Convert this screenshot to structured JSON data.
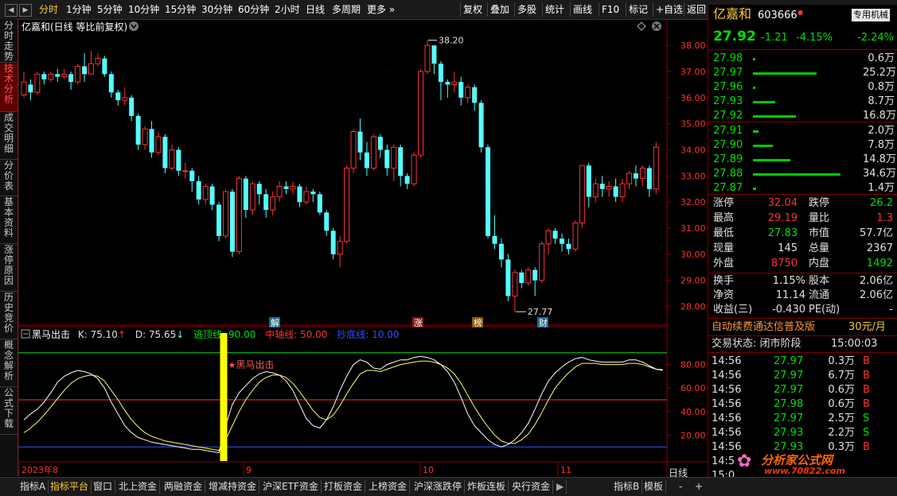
{
  "toolbar": {
    "periods": [
      "分时",
      "1分钟",
      "5分钟",
      "10分钟",
      "15分钟",
      "30分钟",
      "60分钟",
      "2小时",
      "日线",
      "多周期",
      "更多"
    ],
    "active_period": "分时",
    "tools": [
      "复权",
      "叠加",
      "多股",
      "统计",
      "画线",
      "F10",
      "标记",
      "+自选",
      "返回"
    ]
  },
  "left_tabs": [
    "分时走势",
    "技术分析",
    "成交明细",
    "分价表",
    "基本资料",
    "涨停原因",
    "历史竞价",
    "概念解析",
    "公式下载"
  ],
  "left_tab_active": "技术分析",
  "main_chart": {
    "title": "亿嘉和(日线 等比前复权)",
    "price_ticks": [
      "38.00",
      "37.00",
      "36.00",
      "35.00",
      "34.00",
      "33.00",
      "32.00",
      "31.00",
      "30.00",
      "29.00",
      "28.00"
    ],
    "high_label": "38.20",
    "low_label": "27.77",
    "event_markers": [
      "解",
      "涨",
      "榜",
      "财"
    ],
    "colors": {
      "up": "#ff3232",
      "down": "#54ffff",
      "grid": "#8b0000"
    }
  },
  "chart_data": {
    "type": "candlestick",
    "ylim": [
      27.5,
      38.4
    ],
    "candles": [
      [
        36.1,
        36.6,
        36.0,
        37.0
      ],
      [
        36.5,
        36.2,
        35.9,
        36.7
      ],
      [
        36.2,
        36.9,
        36.1,
        37.0
      ],
      [
        36.9,
        36.7,
        36.5,
        37.0
      ],
      [
        36.7,
        36.9,
        36.6,
        37.0
      ],
      [
        36.9,
        36.8,
        36.6,
        37.1
      ],
      [
        36.8,
        36.9,
        36.7,
        37.1
      ],
      [
        36.9,
        36.6,
        36.3,
        37.0
      ],
      [
        36.6,
        37.2,
        36.5,
        37.3
      ],
      [
        37.2,
        36.9,
        36.6,
        37.7
      ],
      [
        36.9,
        37.3,
        36.9,
        37.8
      ],
      [
        37.3,
        37.5,
        37.2,
        37.7
      ],
      [
        37.5,
        36.9,
        36.8,
        37.6
      ],
      [
        36.9,
        36.2,
        36.0,
        37.0
      ],
      [
        36.2,
        35.9,
        35.7,
        36.3
      ],
      [
        35.9,
        36.0,
        35.7,
        36.4
      ],
      [
        36.0,
        35.3,
        35.1,
        36.1
      ],
      [
        35.3,
        34.2,
        34.0,
        35.4
      ],
      [
        34.2,
        34.8,
        34.0,
        34.9
      ],
      [
        34.8,
        33.9,
        33.7,
        35.1
      ],
      [
        33.9,
        34.5,
        33.8,
        34.7
      ],
      [
        34.5,
        33.3,
        33.1,
        34.6
      ],
      [
        33.3,
        34.0,
        33.2,
        34.2
      ],
      [
        34.0,
        33.2,
        33.0,
        34.1
      ],
      [
        33.2,
        33.2,
        32.9,
        33.5
      ],
      [
        33.2,
        32.8,
        32.4,
        33.3
      ],
      [
        32.8,
        32.1,
        31.9,
        33.0
      ],
      [
        32.1,
        32.6,
        31.9,
        32.7
      ],
      [
        32.6,
        31.9,
        31.7,
        32.7
      ],
      [
        31.9,
        30.7,
        30.5,
        32.0
      ],
      [
        30.7,
        32.4,
        30.6,
        32.5
      ],
      [
        32.4,
        30.1,
        29.9,
        32.5
      ],
      [
        30.1,
        32.9,
        30.0,
        33.0
      ],
      [
        32.9,
        31.7,
        31.4,
        33.0
      ],
      [
        31.7,
        32.7,
        31.5,
        32.8
      ],
      [
        32.7,
        32.3,
        31.9,
        32.8
      ],
      [
        32.3,
        31.7,
        31.4,
        32.5
      ],
      [
        31.7,
        32.2,
        31.5,
        32.4
      ],
      [
        32.2,
        32.6,
        32.0,
        32.8
      ],
      [
        32.6,
        32.5,
        32.3,
        32.8
      ],
      [
        32.5,
        32.6,
        32.3,
        32.8
      ],
      [
        32.6,
        32.0,
        31.8,
        32.7
      ],
      [
        32.0,
        32.4,
        31.9,
        32.6
      ],
      [
        32.4,
        32.3,
        32.0,
        32.5
      ],
      [
        32.3,
        31.6,
        31.5,
        32.4
      ],
      [
        31.6,
        30.9,
        30.7,
        31.7
      ],
      [
        30.9,
        30.0,
        29.8,
        31.0
      ],
      [
        30.0,
        30.5,
        29.5,
        30.7
      ],
      [
        30.5,
        33.3,
        30.4,
        33.4
      ],
      [
        33.3,
        34.7,
        33.1,
        34.8
      ],
      [
        34.7,
        33.9,
        33.6,
        35.2
      ],
      [
        33.9,
        33.3,
        33.0,
        34.3
      ],
      [
        33.3,
        34.5,
        33.2,
        34.6
      ],
      [
        34.5,
        34.0,
        33.7,
        34.6
      ],
      [
        34.0,
        33.3,
        33.0,
        34.2
      ],
      [
        33.3,
        34.1,
        32.8,
        34.2
      ],
      [
        34.1,
        33.0,
        32.6,
        34.2
      ],
      [
        33.0,
        32.7,
        32.5,
        33.1
      ],
      [
        32.7,
        33.8,
        32.6,
        33.9
      ],
      [
        33.8,
        37.0,
        33.7,
        37.1
      ],
      [
        37.0,
        38.0,
        36.9,
        38.2
      ],
      [
        38.0,
        37.3,
        36.9,
        38.0
      ],
      [
        37.3,
        36.6,
        35.9,
        37.4
      ],
      [
        36.6,
        36.5,
        36.0,
        36.7
      ],
      [
        36.5,
        36.6,
        36.2,
        37.0
      ],
      [
        36.6,
        36.0,
        35.7,
        36.8
      ],
      [
        36.0,
        36.4,
        35.8,
        36.5
      ],
      [
        36.4,
        35.8,
        35.5,
        36.5
      ],
      [
        35.8,
        34.1,
        33.9,
        35.9
      ],
      [
        34.1,
        30.7,
        30.6,
        34.2
      ],
      [
        30.7,
        30.4,
        30.2,
        31.5
      ],
      [
        30.4,
        29.8,
        29.5,
        30.6
      ],
      [
        29.8,
        28.4,
        28.2,
        30.0
      ],
      [
        28.4,
        29.3,
        27.8,
        29.4
      ],
      [
        29.3,
        28.9,
        28.7,
        29.4
      ],
      [
        28.9,
        29.4,
        28.8,
        29.5
      ],
      [
        29.4,
        29.0,
        28.4,
        29.5
      ],
      [
        29.0,
        30.4,
        28.9,
        30.5
      ],
      [
        30.4,
        30.9,
        30.0,
        31.0
      ],
      [
        30.9,
        30.6,
        30.4,
        31.0
      ],
      [
        30.6,
        30.4,
        30.1,
        30.8
      ],
      [
        30.4,
        30.2,
        30.0,
        30.6
      ],
      [
        30.2,
        31.2,
        30.1,
        31.3
      ],
      [
        31.2,
        33.4,
        31.0,
        33.4
      ],
      [
        33.4,
        32.2,
        31.8,
        33.5
      ],
      [
        32.2,
        32.7,
        32.0,
        32.9
      ],
      [
        32.7,
        32.5,
        32.2,
        33.0
      ],
      [
        32.5,
        32.6,
        32.2,
        32.8
      ],
      [
        32.6,
        32.2,
        32.0,
        32.9
      ],
      [
        32.2,
        32.7,
        32.0,
        32.9
      ],
      [
        32.7,
        33.1,
        32.5,
        33.2
      ],
      [
        33.1,
        32.9,
        32.6,
        33.4
      ],
      [
        32.9,
        33.3,
        32.6,
        33.4
      ],
      [
        33.3,
        32.5,
        32.2,
        33.4
      ],
      [
        32.5,
        34.1,
        32.3,
        34.3
      ]
    ],
    "x_labels": [
      "2023年8",
      "9",
      "10",
      "11"
    ]
  },
  "indicator": {
    "name": "黑马出击",
    "k_label": "K: 75.10",
    "d_label": "D: 75.65",
    "top_line_label": "逃顶线: 90.00",
    "mid_line_label": "中轴线: 50.00",
    "bottom_line_label": "抄底线: 10.00",
    "signal_label": "黑马出击",
    "y_ticks": [
      "80.00",
      "60.00",
      "40.00",
      "20.00"
    ],
    "ylim": [
      0,
      100
    ],
    "levels": {
      "top": 90,
      "mid": 50,
      "bottom": 10
    },
    "k": [
      33,
      38,
      42,
      48,
      56,
      65,
      70,
      73,
      75,
      74,
      72,
      68,
      60,
      48,
      38,
      28,
      22,
      18,
      16,
      14,
      13,
      12,
      11,
      10,
      9,
      8,
      8,
      7,
      6,
      5,
      28,
      46,
      56,
      62,
      68,
      72,
      74,
      73,
      71,
      66,
      58,
      46,
      34,
      28,
      26,
      33,
      44,
      58,
      70,
      80,
      84,
      82,
      77,
      76,
      80,
      82,
      84,
      84,
      86,
      87,
      86,
      84,
      80,
      74,
      65,
      52,
      38,
      28,
      22,
      16,
      12,
      10,
      12,
      16,
      22,
      30,
      42,
      55,
      66,
      73,
      78,
      82,
      85,
      86,
      84,
      83,
      82,
      82,
      82,
      82,
      84,
      84,
      82,
      79,
      76,
      75
    ],
    "d": [
      22,
      26,
      31,
      37,
      44,
      51,
      58,
      64,
      68,
      70,
      71,
      70,
      66,
      58,
      50,
      41,
      33,
      27,
      22,
      19,
      17,
      15,
      14,
      13,
      12,
      11,
      10,
      9,
      8,
      7,
      16,
      28,
      40,
      50,
      58,
      65,
      69,
      71,
      71,
      69,
      64,
      57,
      49,
      41,
      35,
      33,
      37,
      45,
      55,
      64,
      72,
      75,
      75,
      74,
      76,
      78,
      80,
      81,
      82,
      83,
      83,
      82,
      80,
      77,
      72,
      64,
      54,
      44,
      35,
      27,
      20,
      15,
      13,
      13,
      16,
      21,
      29,
      39,
      50,
      60,
      67,
      73,
      78,
      81,
      81,
      81,
      80,
      80,
      80,
      80,
      81,
      81,
      80,
      78,
      76,
      75.65
    ]
  },
  "stock": {
    "name": "亿嘉和",
    "code": "603666",
    "tag": "专用机械",
    "price": "27.92",
    "change": "-1.21",
    "change_pct": "-4.15%",
    "industry_pct": "-2.24%"
  },
  "order_book": {
    "asks": [
      {
        "price": "27.98",
        "vol": "0.6万",
        "bar": 0.02
      },
      {
        "price": "27.97",
        "vol": "25.2万",
        "bar": 0.73
      },
      {
        "price": "27.96",
        "vol": "0.8万",
        "bar": 0.02
      },
      {
        "price": "27.93",
        "vol": "8.7万",
        "bar": 0.25
      },
      {
        "price": "27.92",
        "vol": "16.8万",
        "bar": 0.49
      }
    ],
    "bids": [
      {
        "price": "27.91",
        "vol": "2.0万",
        "bar": 0.06
      },
      {
        "price": "27.90",
        "vol": "7.8万",
        "bar": 0.23
      },
      {
        "price": "27.89",
        "vol": "14.8万",
        "bar": 0.43
      },
      {
        "price": "27.88",
        "vol": "34.6万",
        "bar": 1.0
      },
      {
        "price": "27.87",
        "vol": "1.4万",
        "bar": 0.04
      }
    ]
  },
  "stats": [
    {
      "l1": "涨停",
      "v1": "32.04",
      "c1": "#ff3232",
      "l2": "跌停",
      "v2": "26.2",
      "c2": "#00e000"
    },
    {
      "l1": "最高",
      "v1": "29.19",
      "c1": "#ff3232",
      "l2": "量比",
      "v2": "1.3",
      "c2": "#ff3232"
    },
    {
      "l1": "最低",
      "v1": "27.83",
      "c1": "#00e000",
      "l2": "市值",
      "v2": "57.7亿",
      "c2": "#e0e0e0"
    },
    {
      "l1": "现量",
      "v1": "145",
      "c1": "#e0e0e0",
      "l2": "总量",
      "v2": "2367",
      "c2": "#e0e0e0"
    },
    {
      "l1": "外盘",
      "v1": "8750",
      "c1": "#ff3232",
      "l2": "内盘",
      "v2": "1492",
      "c2": "#00e000"
    }
  ],
  "stats2": [
    {
      "l1": "换手",
      "v1": "1.15%",
      "l2": "股本",
      "v2": "2.06亿"
    },
    {
      "l1": "净资",
      "v1": "11.14",
      "l2": "流通",
      "v2": "2.06亿"
    },
    {
      "l1": "收益(三)",
      "v1": "-0.430",
      "l2": "PE(动)",
      "v2": "-"
    }
  ],
  "promo": {
    "text": "自动续费通达信普及版",
    "price": "30元/月"
  },
  "trade_status": {
    "label": "交易状态: 闭市阶段",
    "time": "15:00:03"
  },
  "trades": [
    {
      "time": "14:56",
      "price": "27.97",
      "vol": "0.3万",
      "side": "B"
    },
    {
      "time": "14:56",
      "price": "27.97",
      "vol": "6.7万",
      "side": "B"
    },
    {
      "time": "14:56",
      "price": "27.97",
      "vol": "0.6万",
      "side": "B"
    },
    {
      "time": "14:56",
      "price": "27.98",
      "vol": "0.6万",
      "side": "B"
    },
    {
      "time": "14:56",
      "price": "27.97",
      "vol": "2.5万",
      "side": "S"
    },
    {
      "time": "14:56",
      "price": "27.93",
      "vol": "2.2万",
      "side": "S"
    },
    {
      "time": "14:56",
      "price": "27.93",
      "vol": "0.3万",
      "side": "B"
    },
    {
      "time": "14:5",
      "price": "",
      "vol": "",
      "side": ""
    },
    {
      "time": "15:0",
      "price": "",
      "vol": "",
      "side": ""
    }
  ],
  "watermark": {
    "brand": "分析家公式网",
    "url": "www.70822.com"
  },
  "bottom_tabs": [
    "指标A",
    "指标平台",
    "窗口",
    "北上资金",
    "两融资金",
    "增减持资金",
    "沪深ETF资金",
    "打板资金",
    "上榜资金",
    "沪深涨跌停",
    "炸板连板",
    "央行资金"
  ],
  "bottom_tab_active": "指标平台",
  "bottom_right": [
    "指标B",
    "模板",
    "日线"
  ]
}
